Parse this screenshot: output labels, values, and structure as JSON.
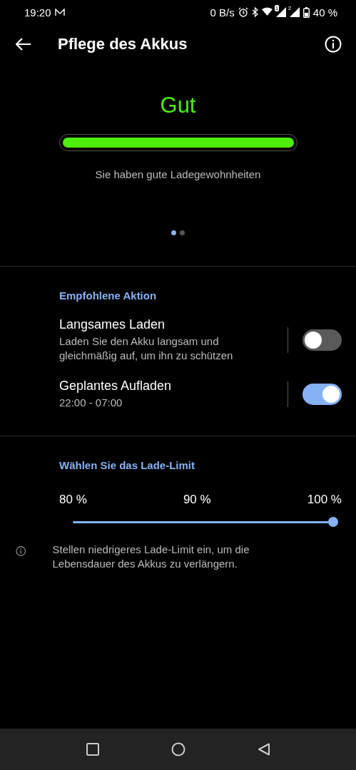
{
  "status_bar": {
    "time": "19:20",
    "speed": "0 B/s",
    "sim_1": "1",
    "sim_2": "2",
    "battery": "40 %"
  },
  "toolbar": {
    "title": "Pflege des Akkus"
  },
  "health": {
    "status": "Gut",
    "level": 1,
    "message": "Sie haben gute Ladegewohnheiten"
  },
  "pages": [
    {
      "selected": true
    },
    {
      "selected": false
    }
  ],
  "recommended": {
    "header": "Empfohlene Aktion",
    "items": [
      {
        "title": "Langsames Laden",
        "subtitle": "Laden Sie den Akku langsam und gleichmäßig auf, um ihn zu schützen",
        "on": false
      },
      {
        "title": "Geplantes Aufladen",
        "subtitle": "22:00 - 07:00",
        "on": true
      }
    ]
  },
  "limit": {
    "header": "Wählen Sie das Lade-Limit",
    "ticks": [
      "80 %",
      "90 %",
      "100 %"
    ],
    "level": 1,
    "note": "Stellen niedrigeres Lade-Limit ein, um die Lebensdauer des Akkus zu verlängern."
  }
}
